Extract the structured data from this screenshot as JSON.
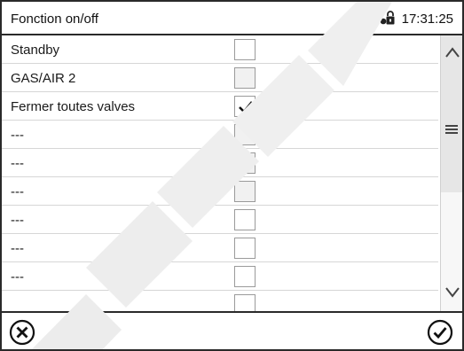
{
  "header": {
    "title": "Fonction on/off",
    "time": "17:31:25",
    "lock_icon": "lock-icon"
  },
  "rows": [
    {
      "label": "Standby",
      "checked": false
    },
    {
      "label": "GAS/AIR 2",
      "checked": false
    },
    {
      "label": "Fermer toutes valves",
      "checked": true
    },
    {
      "label": "---",
      "checked": false
    },
    {
      "label": "---",
      "checked": false
    },
    {
      "label": "---",
      "checked": false
    },
    {
      "label": "---",
      "checked": false
    },
    {
      "label": "---",
      "checked": false
    },
    {
      "label": "---",
      "checked": false
    }
  ],
  "scrollbar": {
    "up_icon": "chevron-up-icon",
    "grip_icon": "menu-lines-icon",
    "down_icon": "chevron-down-icon"
  },
  "footer": {
    "cancel_icon": "circle-x-icon",
    "confirm_icon": "circle-check-icon"
  },
  "colors": {
    "border": "#2a2a2a",
    "row_divider": "#d6d6d6",
    "watermark": "#e9e9e9"
  }
}
